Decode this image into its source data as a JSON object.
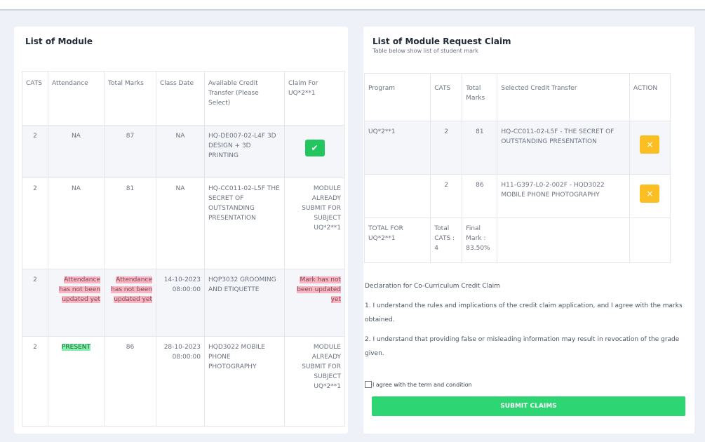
{
  "left": {
    "title": "List of Module",
    "headers": [
      "CATS",
      "Attendance",
      "Total Marks",
      "Class Date",
      "Available Credit Transfer (Please Select)",
      "Claim For UQ*2**1"
    ],
    "rows": [
      {
        "cats": "2",
        "attendance": "NA",
        "total": "87",
        "date": "NA",
        "credit": "HQ-DE007-02-L4F 3D DESIGN + 3D PRINTING",
        "claim_type": "check"
      },
      {
        "cats": "2",
        "attendance": "NA",
        "total": "81",
        "date": "NA",
        "credit": "HQ-CC011-02-L5F THE SECRET OF OUTSTANDING PRESENTATION",
        "claim_text": "MODULE ALREADY SUBMIT FOR SUBJECT UQ*2**1"
      },
      {
        "cats": "2",
        "attendance": "Attendance has not been updated yet",
        "total": "Attendance has not been updated yet",
        "date": "14-10-2023 08:00:00",
        "credit": "HQP3032 GROOMING AND ETIQUETTE",
        "claim_text": "Mark has not been updated yet"
      },
      {
        "cats": "2",
        "attendance": "PRESENT",
        "total": "86",
        "date": "28-10-2023 08:00:00",
        "credit": "HQD3022 MOBILE PHONE PHOTOGRAPHY",
        "claim_text": "MODULE ALREADY SUBMIT FOR SUBJECT UQ*2**1"
      }
    ]
  },
  "right": {
    "title": "List of Module Request Claim",
    "subtitle": "Table below show list of student mark",
    "headers": [
      "Program",
      "CATS",
      "Total Marks",
      "Selected Credit Transfer",
      "ACTION"
    ],
    "rows": [
      {
        "program": "UQ*2**1",
        "cats": "2",
        "total": "81",
        "credit": "HQ-CC011-02-L5F - THE SECRET OF OUTSTANDING PRESENTATION"
      },
      {
        "program": "",
        "cats": "2",
        "total": "86",
        "credit": "H11-G397-L0-2-002F - HQD3022 MOBILE PHONE PHOTOGRAPHY"
      }
    ],
    "total_row": {
      "label": "TOTAL FOR UQ*2**1",
      "cats": "Total CATS : 4",
      "mark": "Final Mark : 83.50%"
    },
    "action_symbol": "×",
    "declaration_title": "Declaration for Co-Curriculum Credit Claim",
    "declaration_1": "1. I understand the rules and implications of the credit claim application, and I agree with the marks obtained.",
    "declaration_2": "2. I understand that providing false or misleading information may result in revocation of the grade given.",
    "agree_label": "I agree with the term and condition",
    "submit_label": "SUBMIT CLAIMS"
  },
  "colors": {
    "check": "#22c55e",
    "action": "#fbbf24",
    "submit": "#2ed573",
    "highlight_red": "#f8b4c0",
    "highlight_green": "#86efac"
  },
  "icons": {
    "check": "check-icon",
    "close": "close-icon"
  }
}
